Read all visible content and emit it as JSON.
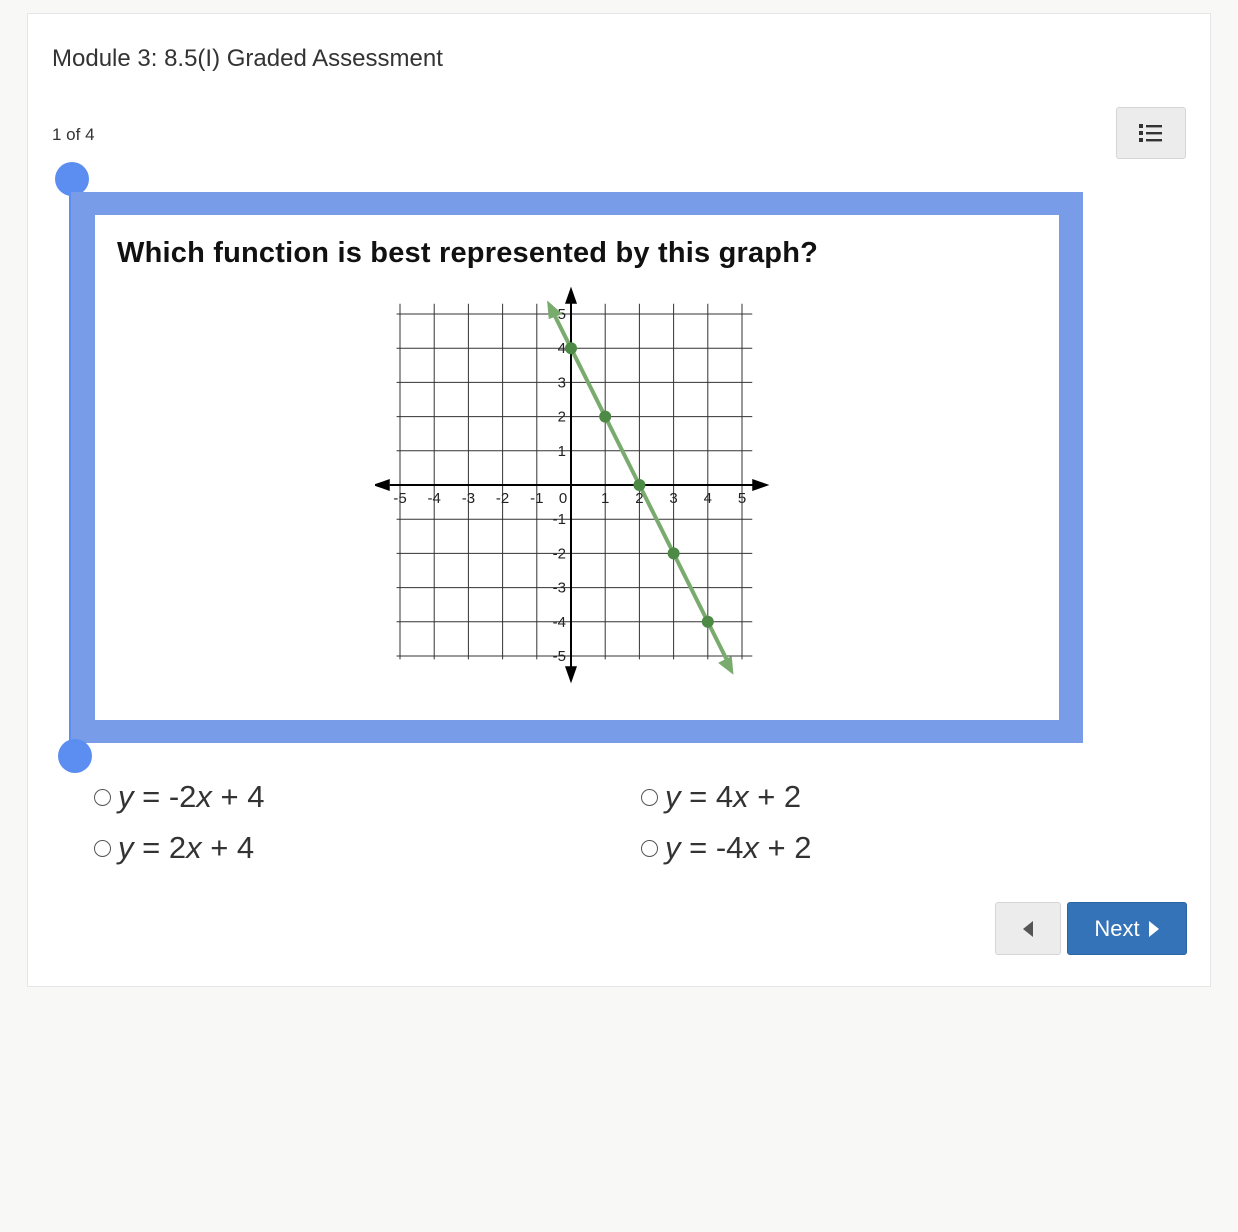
{
  "header": {
    "title": "Module 3: 8.5(I) Graded Assessment",
    "progress": "1 of 4"
  },
  "question": {
    "text": "Which function is best represented by this graph?",
    "graph": {
      "x_ticks": [
        "-5",
        "-4",
        "-3",
        "-2",
        "-1",
        "0",
        "1",
        "2",
        "3",
        "4",
        "5"
      ],
      "y_ticks_pos": [
        "5",
        "4",
        "3",
        "2",
        "1"
      ],
      "y_ticks_neg": [
        "-1",
        "-2",
        "-3",
        "-4",
        "-5"
      ],
      "points": [
        [
          0,
          4
        ],
        [
          1,
          2
        ],
        [
          2,
          0
        ],
        [
          3,
          -2
        ],
        [
          4,
          -4
        ]
      ],
      "line_color": "#7aab6e",
      "point_color": "#4d8a45"
    }
  },
  "choices": [
    {
      "var": "y",
      "eq": " = -2",
      "var2": "x",
      "rest": " + 4"
    },
    {
      "var": "y",
      "eq": " = 4",
      "var2": "x",
      "rest": " + 2"
    },
    {
      "var": "y",
      "eq": " = 2",
      "var2": "x",
      "rest": " + 4"
    },
    {
      "var": "y",
      "eq": " = -4",
      "var2": "x",
      "rest": " + 2"
    }
  ],
  "nav": {
    "next_label": "Next"
  },
  "icons": {
    "menu": "list-icon",
    "prev": "caret-left-icon",
    "next": "caret-right-icon"
  },
  "colors": {
    "accent": "#5b8ef0",
    "frame": "#789ce8",
    "next_button": "#3573b8"
  }
}
